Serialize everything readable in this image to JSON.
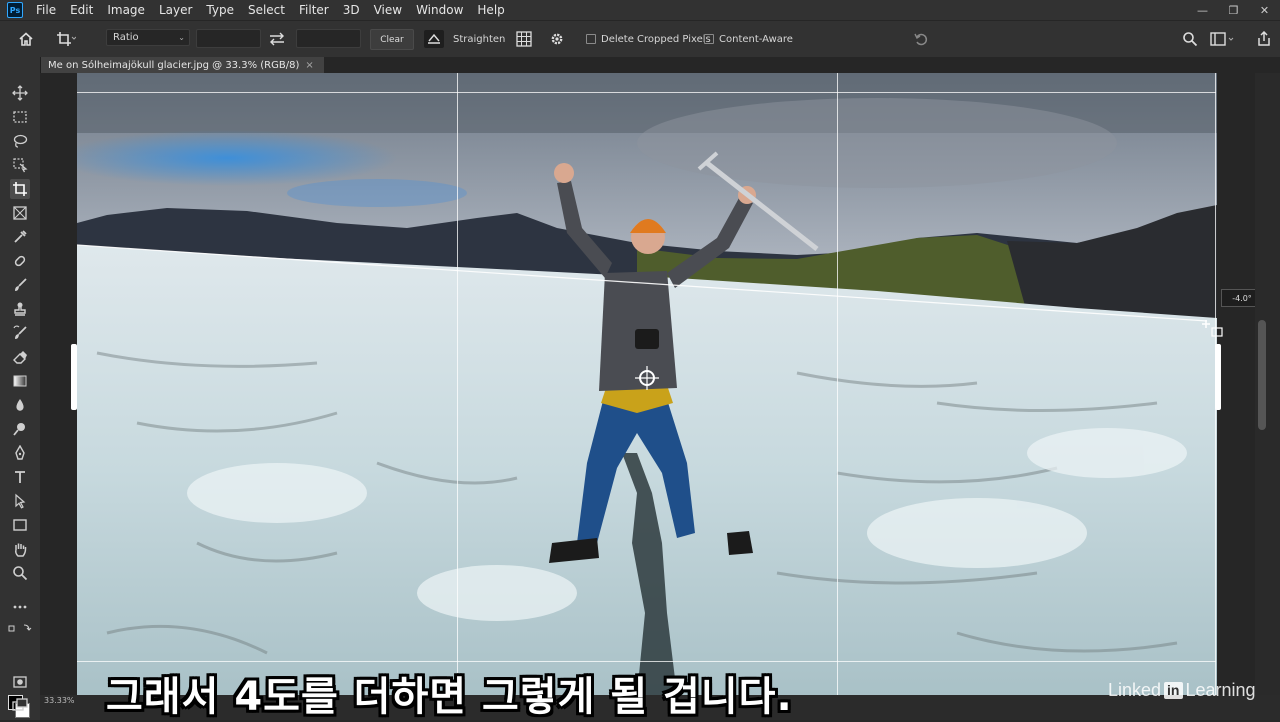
{
  "menu": {
    "logo": "Ps",
    "items": [
      "File",
      "Edit",
      "Image",
      "Layer",
      "Type",
      "Select",
      "Filter",
      "3D",
      "View",
      "Window",
      "Help"
    ]
  },
  "window_controls": {
    "minimize": "—",
    "restore": "❐",
    "close": "✕"
  },
  "options_bar": {
    "ratio_label": "Ratio",
    "clear_label": "Clear",
    "straighten_label": "Straighten",
    "delete_cropped_label": "Delete Cropped Pixels",
    "content_aware_label": "Content-Aware"
  },
  "document": {
    "tab_title": "Me on Sólheimajökull glacier.jpg @ 33.3% (RGB/8)",
    "tab_close": "×"
  },
  "canvas": {
    "angle_readout": "-4.0°"
  },
  "status": {
    "zoom": "33.33%"
  },
  "overlay": {
    "subtitle": "그래서 4도를 더하면 그렇게 될 겁니다.",
    "watermark_pre": "Linked",
    "watermark_in": "in",
    "watermark_post": "Learning"
  },
  "colors": {
    "ui_dark": "#323232",
    "canvas_bg": "#262626",
    "accent": "#31a8ff"
  }
}
